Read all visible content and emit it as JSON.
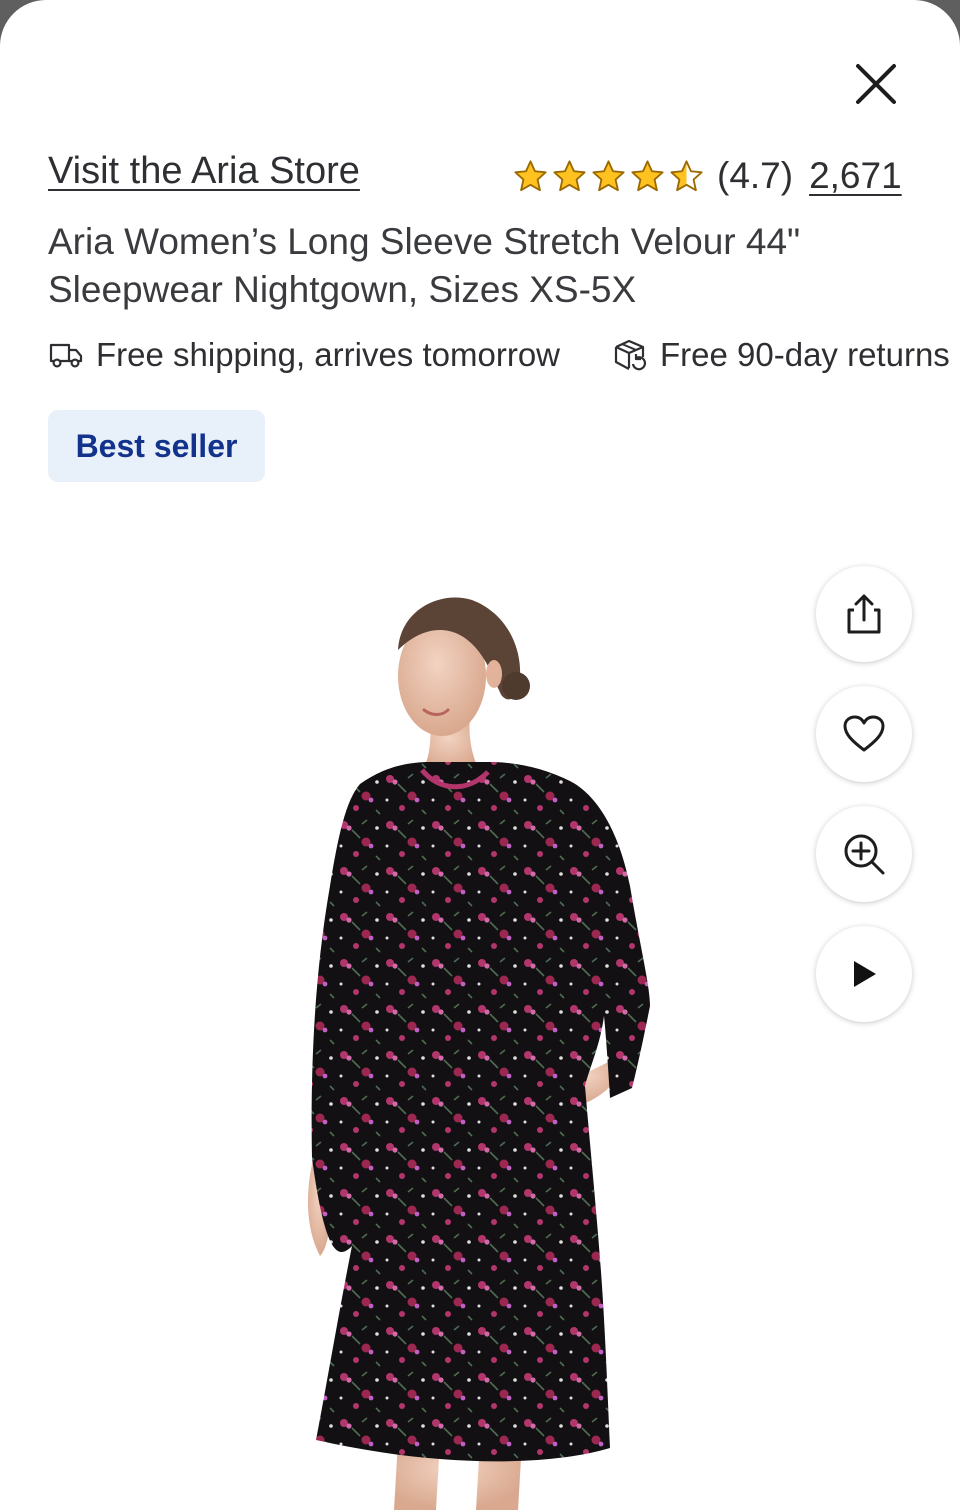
{
  "header": {
    "store_link": "Visit the Aria Store",
    "rating": {
      "stars": 4.7,
      "value_label": "(4.7)",
      "review_count": "2,671"
    }
  },
  "product": {
    "title": "Aria Women’s Long Sleeve Stretch Velour 44\" Sleepwear Nightgown, Sizes XS-5X",
    "badge": "Best seller"
  },
  "benefits": [
    {
      "icon": "truck-icon",
      "label": "Free shipping, arrives tomorrow"
    },
    {
      "icon": "return-box-icon",
      "label": "Free 90-day returns"
    }
  ],
  "actions": [
    {
      "icon": "share-icon"
    },
    {
      "icon": "heart-icon"
    },
    {
      "icon": "zoom-in-icon"
    },
    {
      "icon": "play-icon"
    }
  ],
  "colors": {
    "text": "#2e2f32",
    "star": "#ffc220",
    "badge_bg": "#e8f0fa",
    "badge_text": "#13328c",
    "dress": "#111111",
    "floral": "#b2356b"
  }
}
